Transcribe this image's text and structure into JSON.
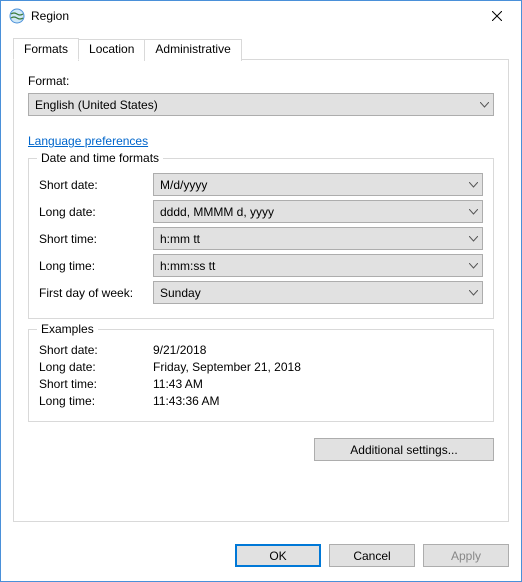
{
  "window": {
    "title": "Region"
  },
  "tabs": {
    "formats": "Formats",
    "location": "Location",
    "administrative": "Administrative"
  },
  "format_label": "Format:",
  "format_value": "English (United States)",
  "link_lang_pref": "Language preferences",
  "group_datetime": "Date and time formats",
  "labels": {
    "short_date": "Short date:",
    "long_date": "Long date:",
    "short_time": "Short time:",
    "long_time": "Long time:",
    "first_day": "First day of week:"
  },
  "values": {
    "short_date": "M/d/yyyy",
    "long_date": "dddd, MMMM d, yyyy",
    "short_time": "h:mm tt",
    "long_time": "h:mm:ss tt",
    "first_day": "Sunday"
  },
  "group_examples": "Examples",
  "ex_labels": {
    "short_date": "Short date:",
    "long_date": "Long date:",
    "short_time": "Short time:",
    "long_time": "Long time:"
  },
  "ex_values": {
    "short_date": "9/21/2018",
    "long_date": "Friday, September 21, 2018",
    "short_time": "11:43 AM",
    "long_time": "11:43:36 AM"
  },
  "buttons": {
    "additional": "Additional settings...",
    "ok": "OK",
    "cancel": "Cancel",
    "apply": "Apply"
  }
}
